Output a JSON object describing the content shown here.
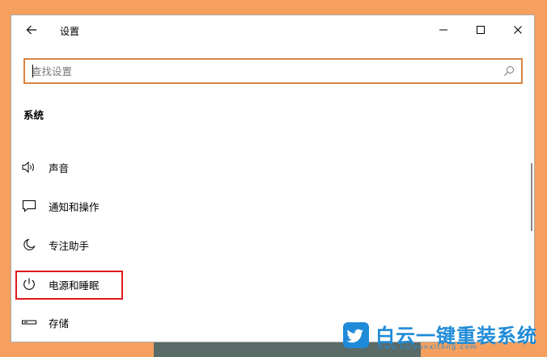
{
  "window": {
    "title": "设置"
  },
  "search": {
    "placeholder": "查找设置"
  },
  "section": {
    "title": "系统"
  },
  "nav": {
    "items": [
      {
        "label": "声音",
        "icon": "speaker-icon"
      },
      {
        "label": "通知和操作",
        "icon": "message-icon"
      },
      {
        "label": "专注助手",
        "icon": "moon-icon"
      },
      {
        "label": "电源和睡眠",
        "icon": "power-icon"
      },
      {
        "label": "存储",
        "icon": "storage-icon"
      }
    ]
  },
  "watermark": {
    "text": "白云一键重装系统",
    "url": "www.baiyunxitong.com"
  },
  "colors": {
    "background": "#F5A05E",
    "search_border": "#D98441",
    "highlight": "#E01B1B",
    "watermark": "#1F8BD8"
  }
}
